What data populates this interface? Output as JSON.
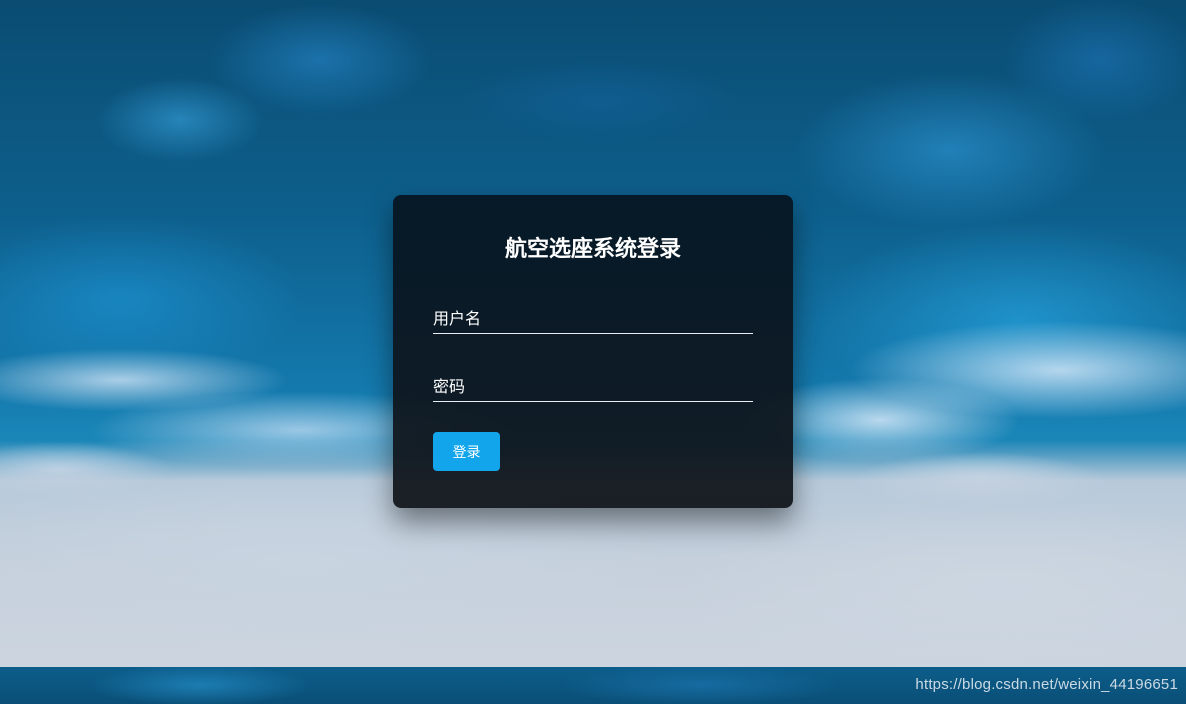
{
  "login": {
    "title": "航空选座系统登录",
    "username_placeholder": "用户名",
    "username_value": "",
    "password_placeholder": "密码",
    "password_value": "",
    "submit_label": "登录"
  },
  "watermark": "https://blog.csdn.net/weixin_44196651",
  "colors": {
    "button": "#12a5ec",
    "card": "#0d1821"
  }
}
